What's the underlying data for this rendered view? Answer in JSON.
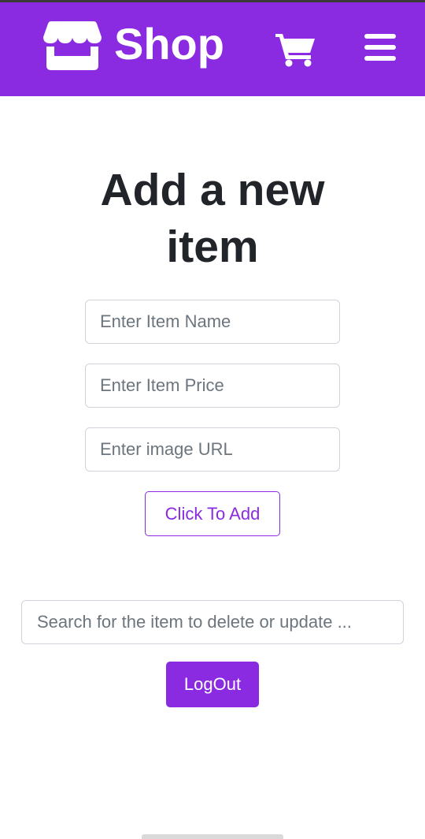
{
  "navbar": {
    "brand_text": "Shop",
    "brand_icon": "store-icon",
    "cart_icon": "shopping-cart-icon",
    "menu_icon": "hamburger-menu-icon",
    "background_color": "#8a2be2"
  },
  "main": {
    "title": "Add a new item",
    "item_name_placeholder": "Enter Item Name",
    "item_price_placeholder": "Enter Item Price",
    "image_url_placeholder": "Enter image URL",
    "add_button_label": "Click To Add",
    "search_placeholder": "Search for the item to delete or update ...",
    "logout_button_label": "LogOut",
    "accent_color": "#8a2be2"
  }
}
